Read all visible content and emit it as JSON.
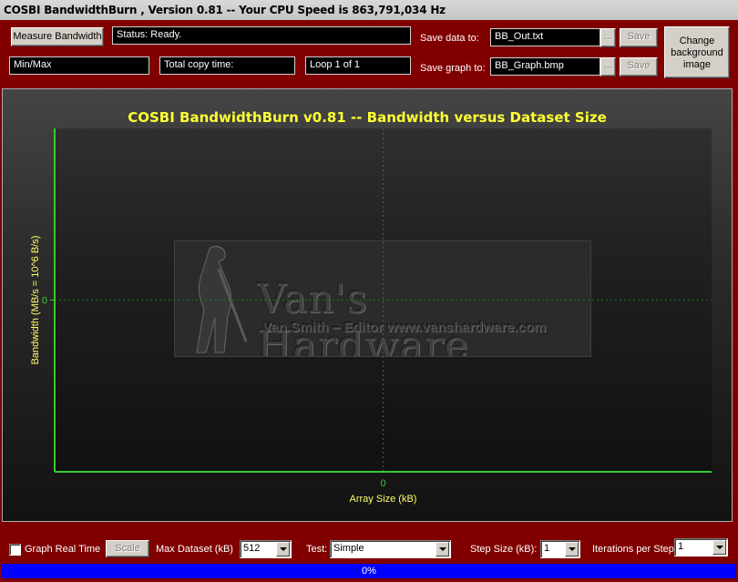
{
  "window": {
    "title": "COSBI BandwidthBurn , Version 0.81 -- Your CPU Speed is 863,791,034 Hz"
  },
  "toolbar": {
    "measure_label": "Measure Bandwidth",
    "status": "Status: Ready.",
    "minmax": "Min/Max",
    "copy_time": "Total copy time:",
    "loop": "Loop 1 of 1",
    "save_data_label": "Save data to:",
    "save_data_value": "BB_Out.txt",
    "save_graph_label": "Save graph to:",
    "save_graph_value": "BB_Graph.bmp",
    "browse_label": "...",
    "save_label": "Save",
    "change_bg_label": "Change background image"
  },
  "chart_data": {
    "type": "line",
    "title": "COSBI BandwidthBurn v0.81 -- Bandwidth versus Dataset Size",
    "xlabel": "Array Size (kB)",
    "ylabel": "Bandwidth (MB/s = 10^6 B/s)",
    "x_ticks": [
      "0"
    ],
    "y_ticks": [
      "0"
    ],
    "series": [],
    "grid": true,
    "colors": {
      "title": "#ffff33",
      "axis": "#33cc33",
      "labels": "#ffff66"
    }
  },
  "logo": {
    "text": "Van's Hardware",
    "subtext": "Van Smith – Editor  www.vanshardware.com"
  },
  "bottom": {
    "graph_realtime_label": "Graph Real Time",
    "scale_label": "Scale",
    "max_dataset_label": "Max Dataset (kB)",
    "max_dataset_value": "512",
    "test_label": "Test:",
    "test_value": "Simple",
    "step_size_label": "Step Size (kB):",
    "step_size_value": "1",
    "iterations_label": "Iterations per Step",
    "iterations_value": "1"
  },
  "progress": {
    "text": "0%",
    "value": 0
  }
}
